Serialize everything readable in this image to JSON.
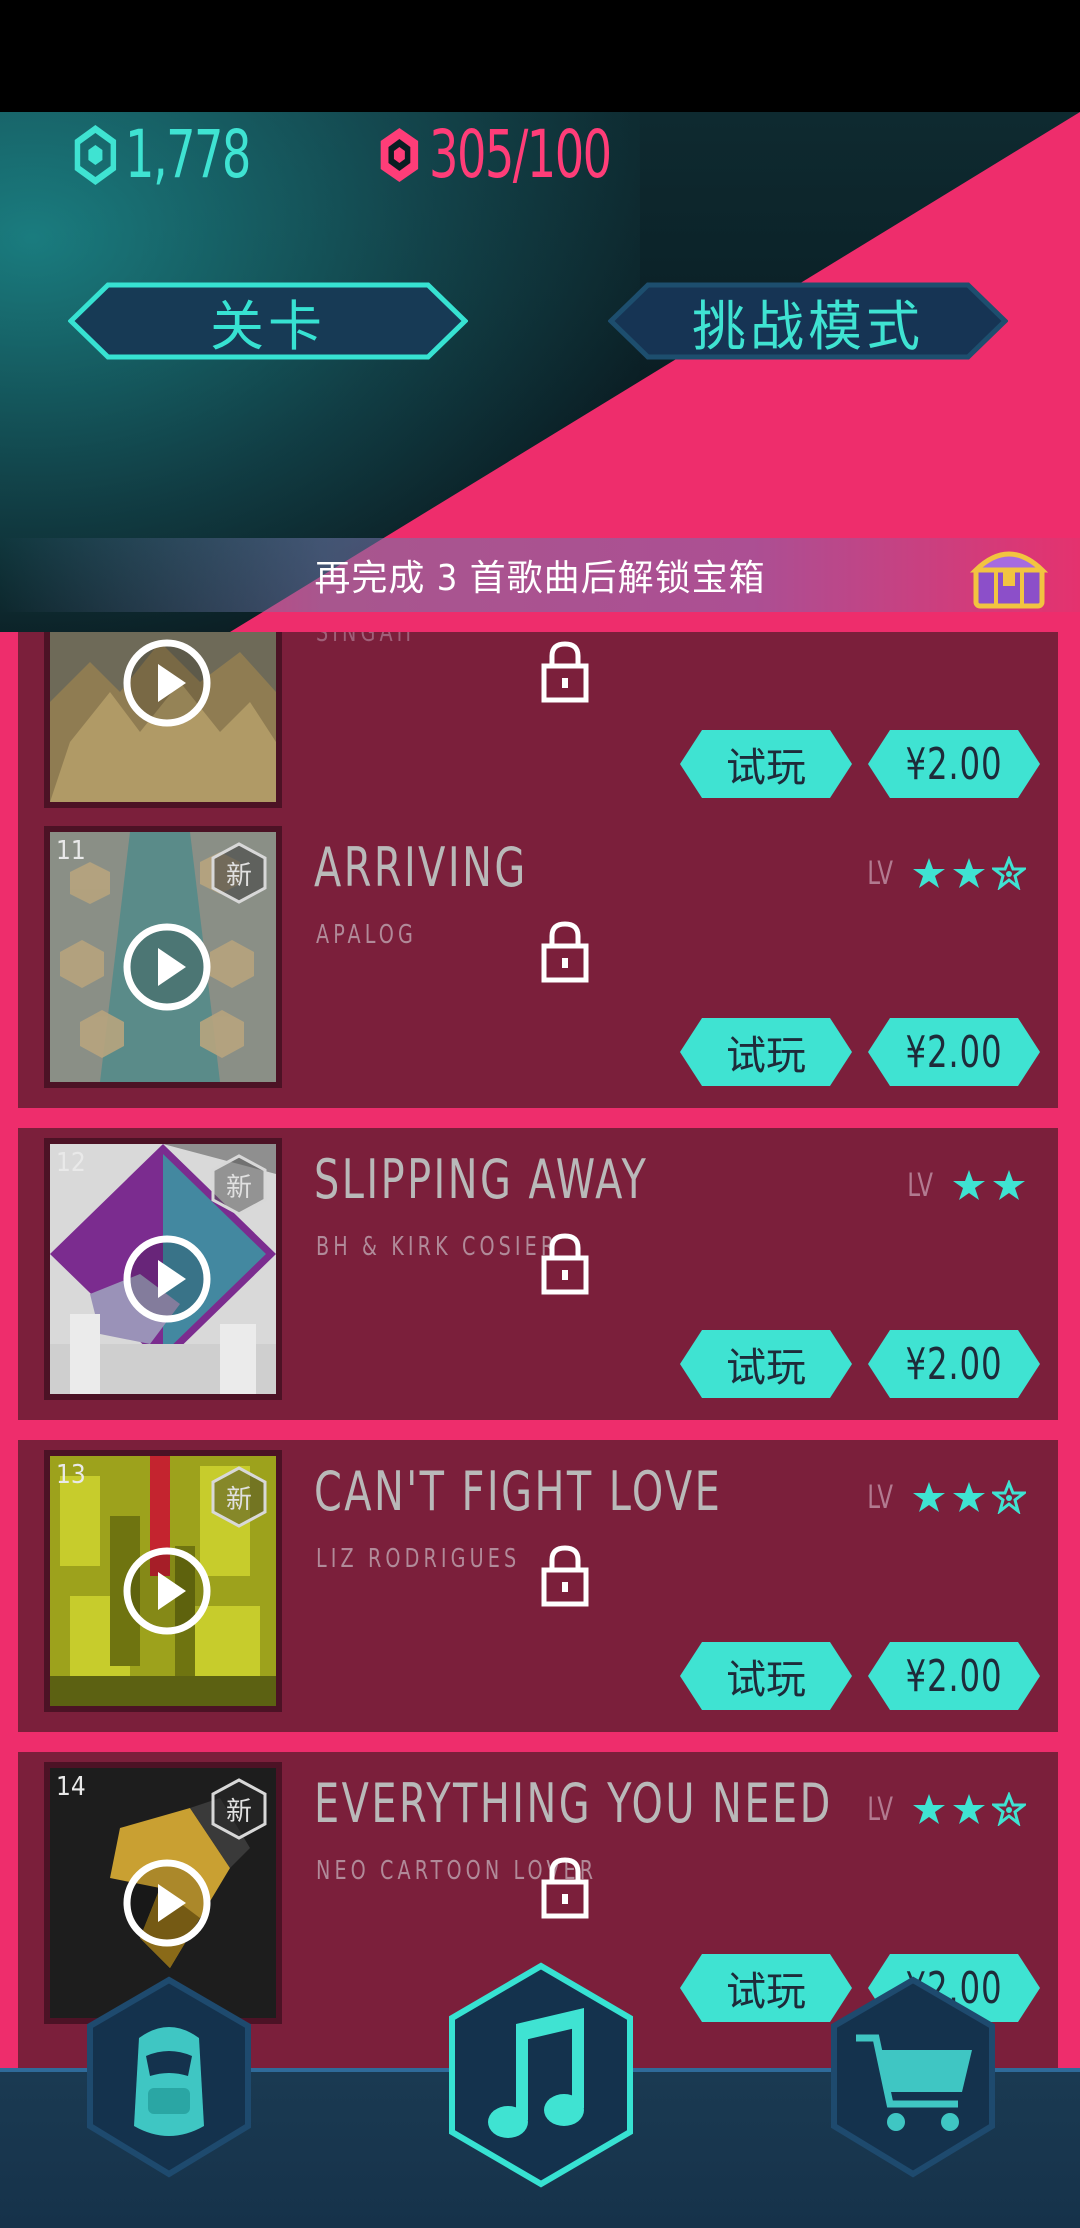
{
  "colors": {
    "teal": "#3fe3d2",
    "pink": "#ee2d6c",
    "card": "#7b1f3b",
    "navy": "#142f4d"
  },
  "currency": {
    "gems_value": "1,778",
    "tokens_value": "305/100"
  },
  "modes": {
    "levels_label": "关卡",
    "challenge_label": "挑战模式"
  },
  "banner": {
    "text": "再完成 3 首歌曲后解锁宝箱"
  },
  "songs": [
    {
      "number": "",
      "title": "",
      "artist": "SINGAH",
      "new_label": "",
      "stars": 0,
      "try_label": "试玩",
      "price": "¥2.00"
    },
    {
      "number": "11",
      "title": "ARRIVING",
      "artist": "APALOG",
      "new_label": "新",
      "lv_label": "LV",
      "stars": 2,
      "max_stars": 3,
      "try_label": "试玩",
      "price": "¥2.00"
    },
    {
      "number": "12",
      "title": "SLIPPING AWAY",
      "artist": "BH & KIRK COSIER",
      "new_label": "新",
      "lv_label": "LV",
      "stars": 2,
      "max_stars": 2,
      "try_label": "试玩",
      "price": "¥2.00"
    },
    {
      "number": "13",
      "title": "CAN'T FIGHT LOVE",
      "artist": "LIZ RODRIGUES",
      "new_label": "新",
      "lv_label": "LV",
      "stars": 2,
      "max_stars": 3,
      "try_label": "试玩",
      "price": "¥2.00"
    },
    {
      "number": "14",
      "title": "EVERYTHING YOU NEED",
      "artist": "NEO CARTOON LOVER",
      "new_label": "新",
      "lv_label": "LV",
      "stars": 2,
      "max_stars": 3,
      "try_label": "试玩",
      "price": "¥2.00"
    }
  ],
  "bottom_nav": {
    "items": [
      "car-icon",
      "music-note-icon",
      "cart-icon"
    ],
    "active": "music-note-icon"
  }
}
